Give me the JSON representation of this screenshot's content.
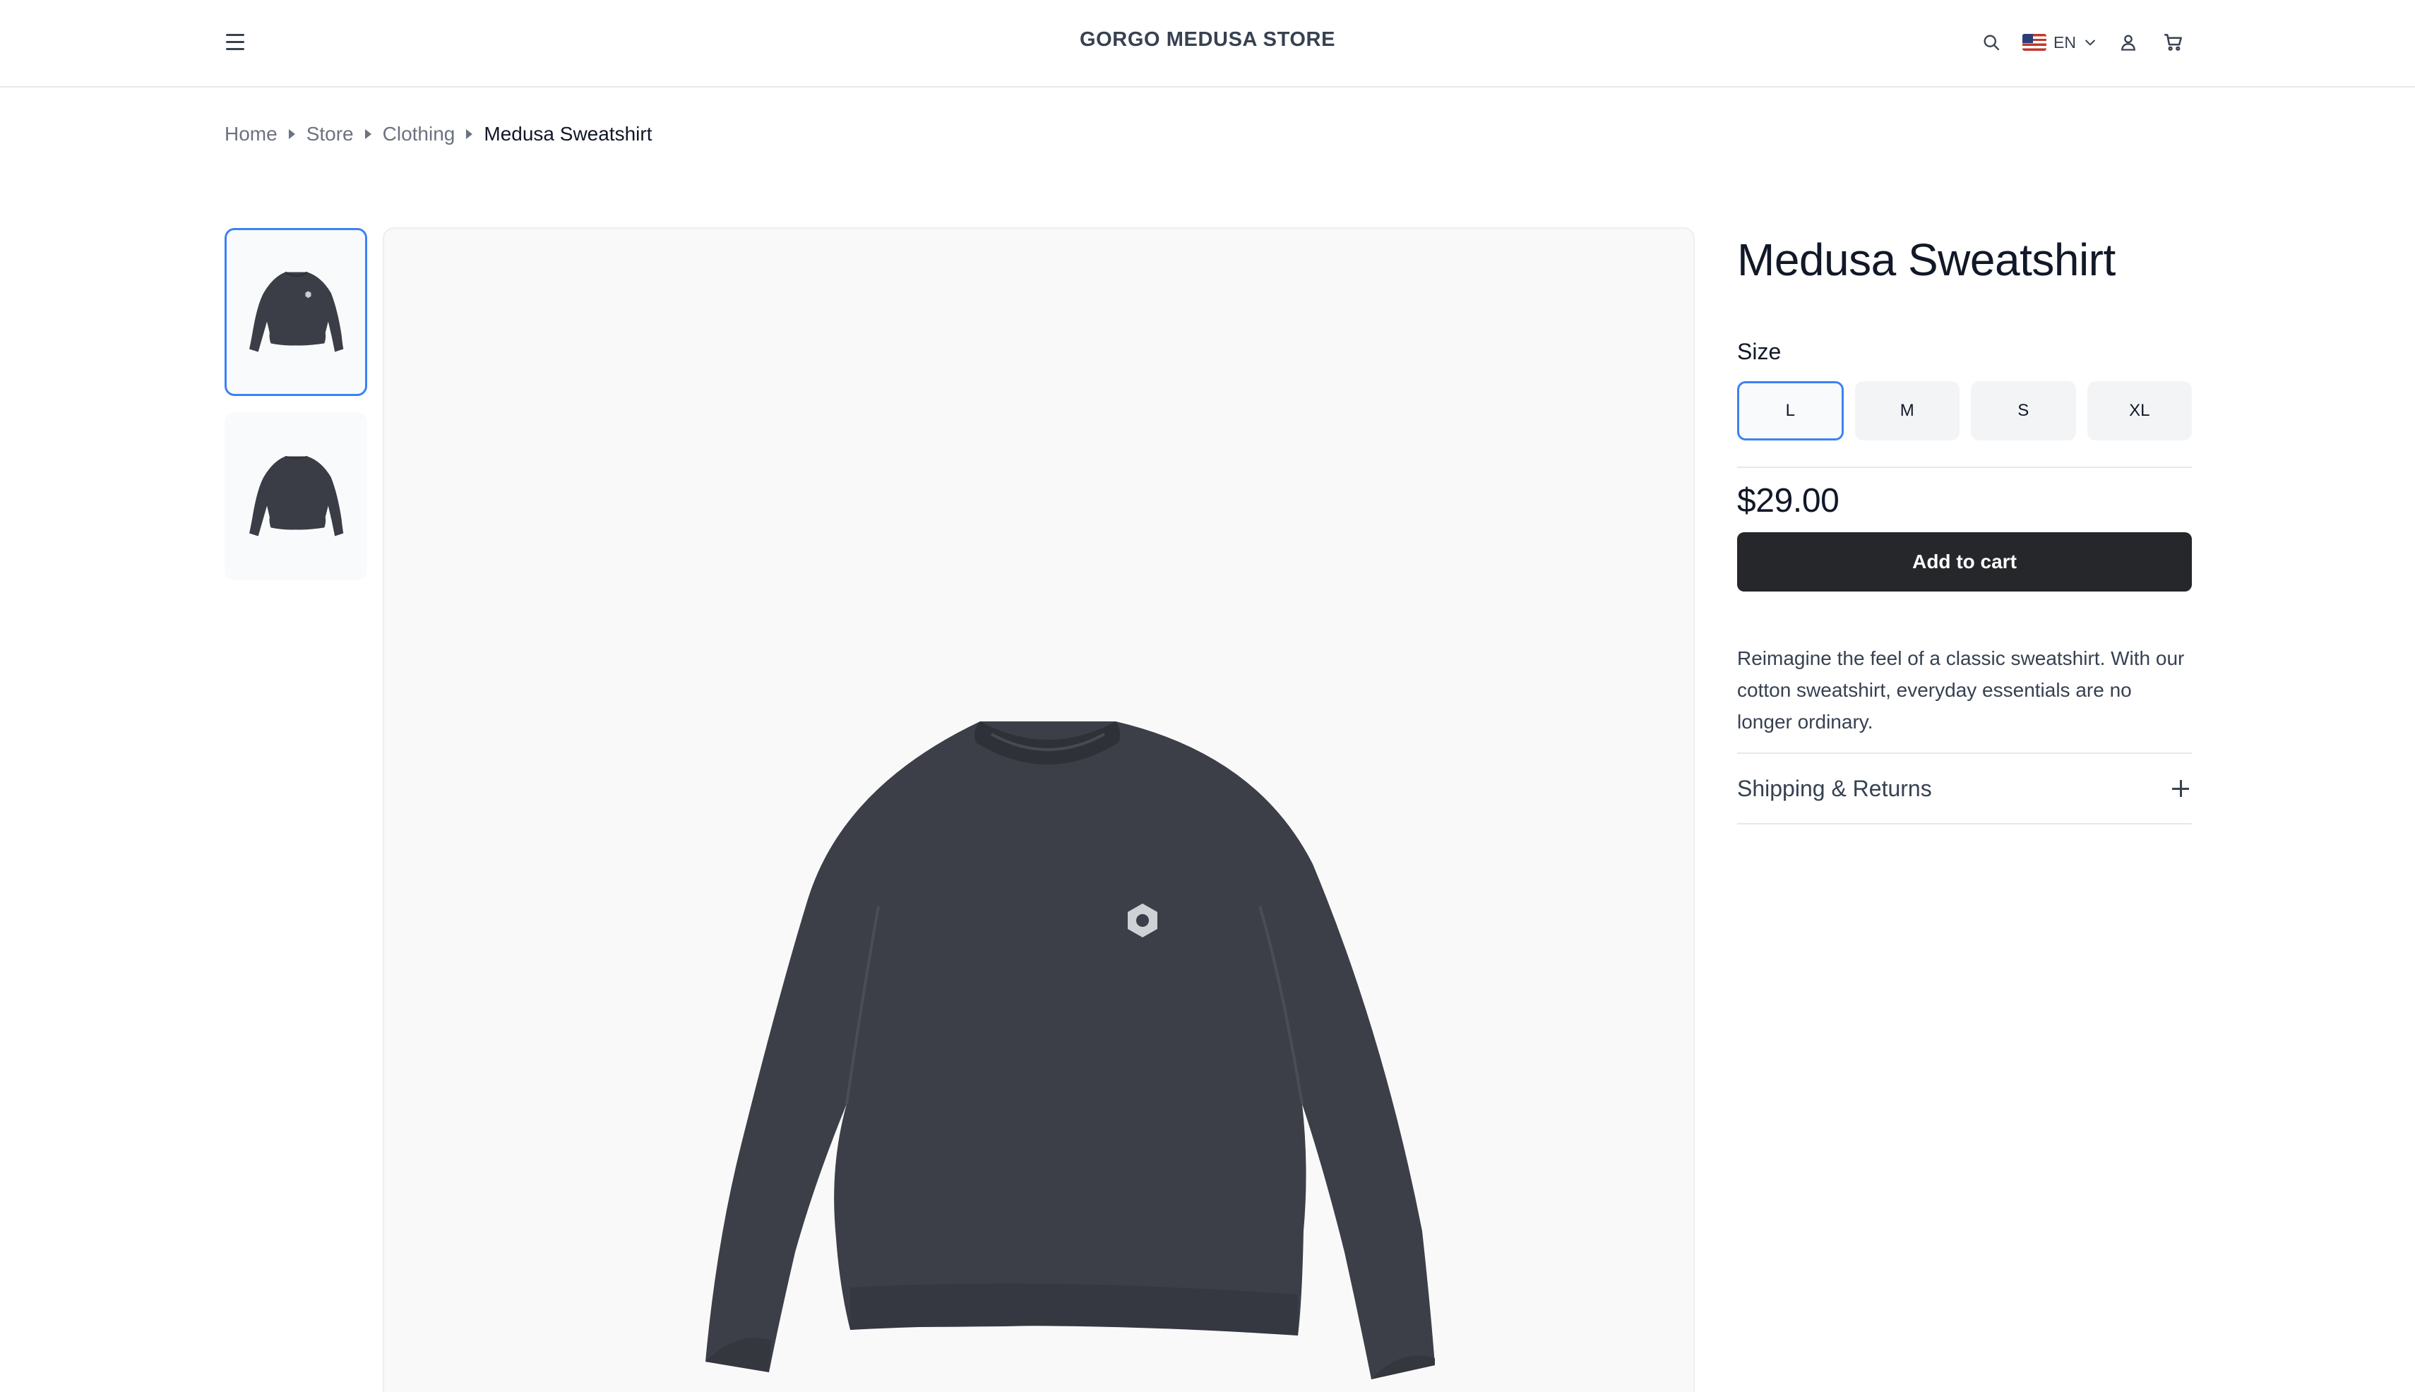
{
  "header": {
    "store_name": "GORGO MEDUSA STORE",
    "language": "EN",
    "icons": {
      "menu": "menu-icon",
      "search": "search-icon",
      "flag": "us-flag-icon",
      "chevron": "chevron-down-icon",
      "account": "user-icon",
      "cart": "cart-icon"
    }
  },
  "breadcrumb": {
    "items": [
      "Home",
      "Store",
      "Clothing"
    ],
    "current": "Medusa Sweatshirt"
  },
  "gallery": {
    "thumbnail_count": 2,
    "selected_thumbnail": 1
  },
  "product": {
    "title": "Medusa Sweatshirt",
    "size_label": "Size",
    "sizes": [
      "L",
      "M",
      "S",
      "XL"
    ],
    "selected_size": "L",
    "price": "$29.00",
    "add_to_cart_label": "Add to cart",
    "description": "Reimagine the feel of a classic sweatshirt. With our cotton sweatshirt, everyday essentials are no longer ordinary.",
    "accordion_label": "Shipping & Returns"
  },
  "colors": {
    "accent": "#3b82f6",
    "button_dark": "#26272b",
    "sweatshirt": "#3b3e46"
  }
}
